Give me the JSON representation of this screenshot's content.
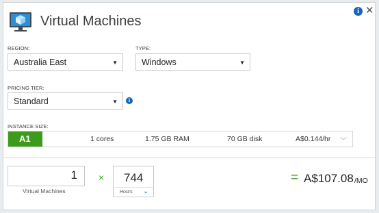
{
  "header": {
    "title": "Virtual Machines",
    "icon": "virtual-machine-monitor-icon",
    "accent_color": "#2a8fd6"
  },
  "region": {
    "label": "REGION:",
    "value": "Australia East"
  },
  "type": {
    "label": "TYPE:",
    "value": "Windows"
  },
  "pricing_tier": {
    "label": "PRICING TIER:",
    "value": "Standard"
  },
  "instance_size": {
    "label": "INSTANCE SIZE:",
    "name": "A1",
    "cores": "1 cores",
    "ram": "1.75 GB RAM",
    "disk": "70 GB disk",
    "price": "A$0.144/hr",
    "badge_color": "#3d9b1c"
  },
  "calculator": {
    "vm_count": "1",
    "vm_label": "Virtual Machines",
    "times": "×",
    "hours": "744",
    "hours_label": "Hours",
    "equals": "=",
    "total": "A$107.08",
    "per": "/MO",
    "accent_color": "#3d9b1c"
  }
}
